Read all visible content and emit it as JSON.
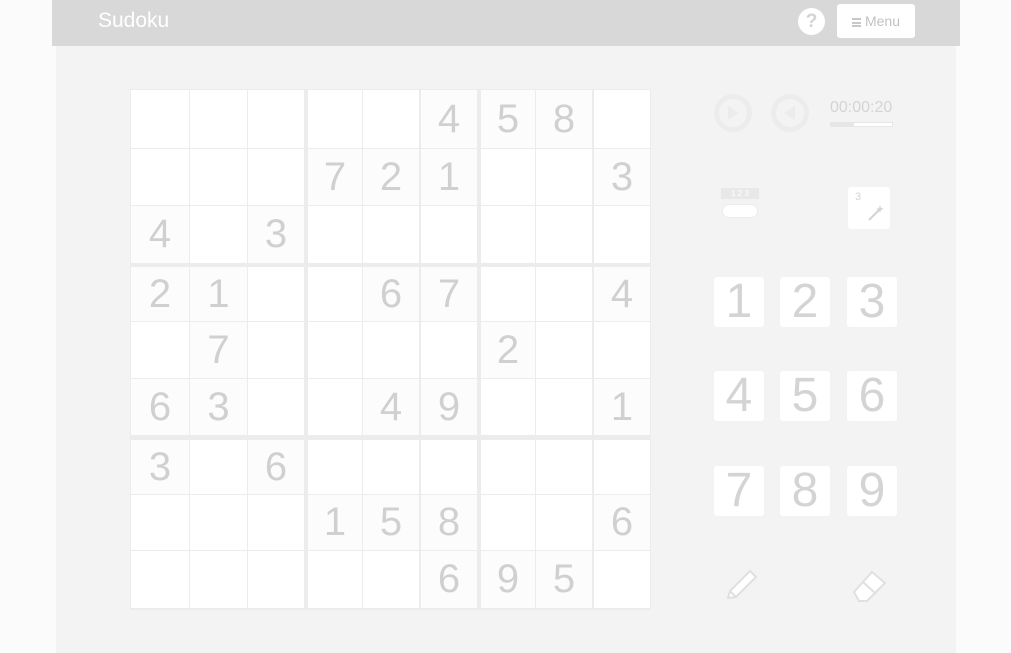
{
  "header": {
    "title": "Sudoku",
    "help_icon": "question-circle-icon",
    "menu_label": "Menu",
    "menu_icon": "hamburger-icon"
  },
  "board": {
    "grid": [
      [
        "",
        "",
        "",
        "",
        "",
        "4",
        "5",
        "8",
        ""
      ],
      [
        "",
        "",
        "",
        "7",
        "2",
        "1",
        "",
        "",
        "3"
      ],
      [
        "4",
        "",
        "3",
        "",
        "",
        "",
        "",
        "",
        ""
      ],
      [
        "2",
        "1",
        "",
        "",
        "6",
        "7",
        "",
        "",
        "4"
      ],
      [
        "",
        "7",
        "",
        "",
        "",
        "",
        "2",
        "",
        ""
      ],
      [
        "6",
        "3",
        "",
        "",
        "4",
        "9",
        "",
        "",
        "1"
      ],
      [
        "3",
        "",
        "6",
        "",
        "",
        "",
        "",
        "",
        ""
      ],
      [
        "",
        "",
        "",
        "1",
        "5",
        "8",
        "",
        "",
        "6"
      ],
      [
        "",
        "",
        "",
        "",
        "",
        "6",
        "9",
        "5",
        ""
      ]
    ]
  },
  "controls": {
    "undo_icon": "undo-icon",
    "redo_icon": "redo-icon",
    "timer": "00:00:20",
    "timer_progress": 0.38,
    "number_toggle_label": "1 2 3",
    "number_toggle_icon": "number-toggle-icon",
    "auto_candidates_label": "3",
    "auto_candidates_icon": "magic-wand-icon",
    "pencil_icon": "pencil-icon",
    "eraser_icon": "eraser-icon"
  },
  "numpad": [
    "1",
    "2",
    "3",
    "4",
    "5",
    "6",
    "7",
    "8",
    "9"
  ],
  "colors": {
    "header_bg": "#d8d8d8",
    "panel_bg": "#f3f3f3",
    "cell_bg": "#ffffff",
    "digit": "#d0d0d0"
  }
}
